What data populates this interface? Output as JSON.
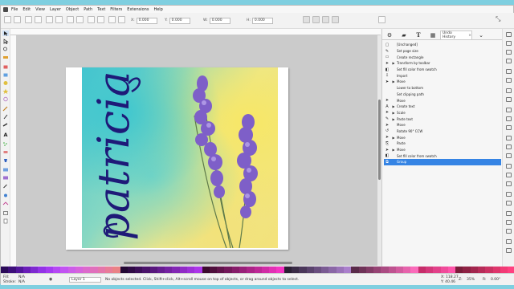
{
  "menu": [
    "File",
    "Edit",
    "View",
    "Layer",
    "Object",
    "Path",
    "Text",
    "Filters",
    "Extensions",
    "Help"
  ],
  "toolbar": {
    "x_label": "X:",
    "x_value": "0.000",
    "y_label": "Y:",
    "y_value": "0.000",
    "w_label": "W:",
    "w_value": "0.000",
    "h_label": "H:",
    "h_value": "0.000"
  },
  "dock": {
    "active_tab": "Undo History",
    "history": [
      {
        "label": "[Unchanged]",
        "icon": "doc-icon",
        "expander": ""
      },
      {
        "label": "Set page size",
        "icon": "pen-icon",
        "expander": ""
      },
      {
        "label": "Create rectangle",
        "icon": "rect-icon",
        "expander": ""
      },
      {
        "label": "Transform by toolbar",
        "icon": "arrow-icon",
        "expander": "▶"
      },
      {
        "label": "Set fill color from swatch",
        "icon": "fill-icon",
        "expander": ""
      },
      {
        "label": "Import",
        "icon": "import-icon",
        "expander": ""
      },
      {
        "label": "Move",
        "icon": "arrow-icon",
        "expander": "▶"
      },
      {
        "label": "Lower to bottom",
        "icon": "",
        "expander": ""
      },
      {
        "label": "Set clipping path",
        "icon": "",
        "expander": ""
      },
      {
        "label": "Move",
        "icon": "arrow-icon",
        "expander": ""
      },
      {
        "label": "Create text",
        "icon": "text-icon",
        "expander": "▶"
      },
      {
        "label": "Scale",
        "icon": "arrow-icon",
        "expander": "▶"
      },
      {
        "label": "Paste text",
        "icon": "pen-icon",
        "expander": "▶"
      },
      {
        "label": "Move",
        "icon": "arrow-icon",
        "expander": ""
      },
      {
        "label": "Rotate 90° CCW",
        "icon": "rotate-icon",
        "expander": ""
      },
      {
        "label": "Move",
        "icon": "arrow-icon",
        "expander": "▶"
      },
      {
        "label": "Paste",
        "icon": "paste-icon",
        "expander": ""
      },
      {
        "label": "Move",
        "icon": "arrow-icon",
        "expander": "▶"
      },
      {
        "label": "Set fill color from swatch",
        "icon": "fill-icon",
        "expander": ""
      },
      {
        "label": "Group",
        "icon": "group-icon",
        "expander": "",
        "selected": true
      }
    ]
  },
  "canvas": {
    "artwork_text": "patricia"
  },
  "status": {
    "fill_label": "Fill:",
    "fill_value": "N/A",
    "stroke_label": "Stroke:",
    "stroke_value": "N/A",
    "layer": "Layer 1",
    "message": "No objects selected. Click, Shift+click, Alt+scroll mouse on top of objects, or drag around objects to select.",
    "x": "X: 118.27",
    "y": "Y: 40.46",
    "zoom": "35%",
    "rotation": "0.00°"
  },
  "palette_colors": [
    "#2b0b59",
    "#3d0f7a",
    "#52169a",
    "#6a1eb8",
    "#7e2ad0",
    "#9333e6",
    "#a43bf0",
    "#b548f4",
    "#c254f2",
    "#cc5ee8",
    "#d664dc",
    "#dc6acc",
    "#e070bc",
    "#e476aa",
    "#e87c98",
    "#ea8286",
    "#220733",
    "#2f0a45",
    "#3c0e58",
    "#4a136a",
    "#58187d",
    "#661d90",
    "#7422a2",
    "#8227b4",
    "#902cc6",
    "#9e31d8",
    "#ac36ea",
    "#3c0b2e",
    "#4e0f3c",
    "#61144b",
    "#73185a",
    "#861c69",
    "#982078",
    "#ab2487",
    "#bd2896",
    "#d02ca5",
    "#e230b4",
    "#f434c3",
    "#2a1f33",
    "#3a2b46",
    "#4a375a",
    "#5a436d",
    "#6a4f80",
    "#7a5b93",
    "#8a67a6",
    "#9a73b9",
    "#aa7fcc",
    "#5a2b4a",
    "#6e3358",
    "#823b66",
    "#964374",
    "#aa4b82",
    "#be5390",
    "#d25b9e",
    "#e663ac",
    "#fa6bba",
    "#c62d6a",
    "#d4377a",
    "#e2418a",
    "#f04b9a",
    "#fe55aa",
    "#7a1d3a",
    "#8e2244",
    "#a2274e",
    "#b62c58",
    "#ca3162",
    "#de366c",
    "#f23b76",
    "#ff4080"
  ]
}
